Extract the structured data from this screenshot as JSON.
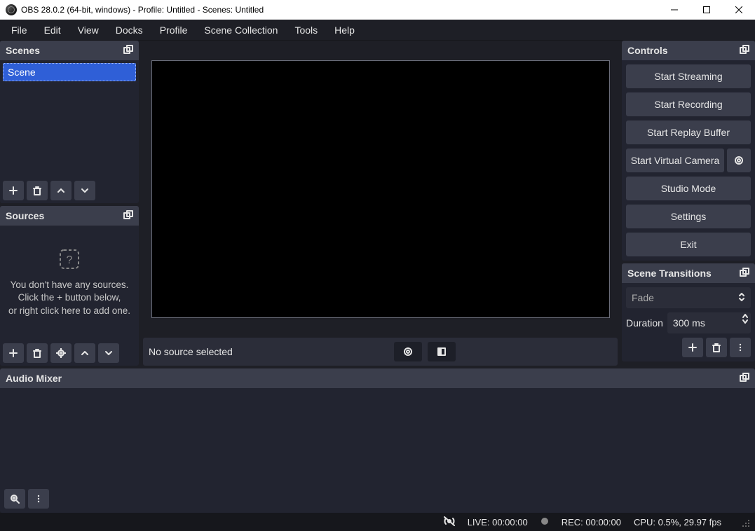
{
  "titlebar": {
    "text": "OBS 28.0.2 (64-bit, windows) - Profile: Untitled - Scenes: Untitled"
  },
  "menu": {
    "items": [
      "File",
      "Edit",
      "View",
      "Docks",
      "Profile",
      "Scene Collection",
      "Tools",
      "Help"
    ]
  },
  "panels": {
    "scenes": {
      "title": "Scenes",
      "items": [
        "Scene"
      ]
    },
    "sources": {
      "title": "Sources",
      "empty_text": "You don't have any sources.\nClick the + button below,\nor right click here to add one."
    },
    "audio_mixer": {
      "title": "Audio Mixer"
    },
    "controls": {
      "title": "Controls",
      "buttons": {
        "start_streaming": "Start Streaming",
        "start_recording": "Start Recording",
        "start_replay_buffer": "Start Replay Buffer",
        "start_virtual_camera": "Start Virtual Camera",
        "studio_mode": "Studio Mode",
        "settings": "Settings",
        "exit": "Exit"
      }
    },
    "scene_transitions": {
      "title": "Scene Transitions",
      "selected": "Fade",
      "duration_label": "Duration",
      "duration_value": "300 ms"
    }
  },
  "source_toolbar": {
    "no_source": "No source selected"
  },
  "statusbar": {
    "live": "LIVE: 00:00:00",
    "rec": "REC: 00:00:00",
    "cpu": "CPU: 0.5%, 29.97 fps"
  }
}
